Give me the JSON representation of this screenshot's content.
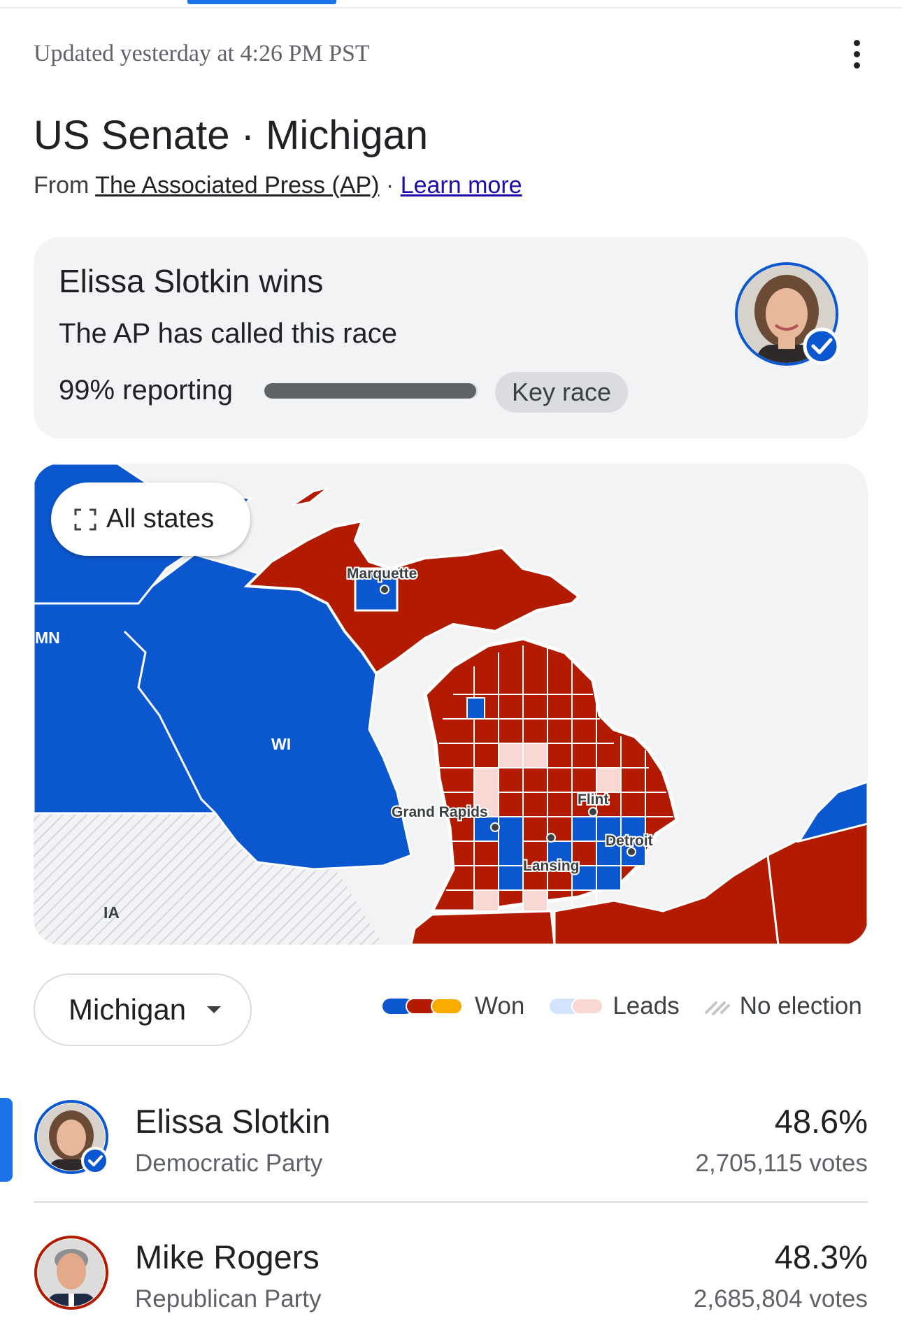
{
  "header": {
    "updated": "Updated yesterday at 4:26 PM PST"
  },
  "race": {
    "title": "US Senate · Michigan",
    "source_prefix": "From",
    "source_name": "The Associated Press (AP)",
    "separator": "·",
    "learn_more": "Learn more"
  },
  "call": {
    "winner_text": "Elissa Slotkin wins",
    "status_text": "The AP has called this race",
    "reporting_text": "99% reporting",
    "reporting_fraction": 0.99,
    "key_race_label": "Key race"
  },
  "map": {
    "all_states_label": "All states",
    "state_labels": [
      "MN",
      "WI",
      "IA"
    ],
    "city_labels": [
      "Marquette",
      "Grand Rapids",
      "Flint",
      "Detroit",
      "Lansing"
    ],
    "colors": {
      "dem_won": "#0b57d0",
      "rep_won": "#b31b00",
      "dem_leads": "#d3e3fd",
      "rep_leads": "#f9d8d4",
      "no_election_hatch": "#dadce0",
      "water": "#f1f3f4"
    }
  },
  "controls": {
    "state_select_value": "Michigan"
  },
  "legend": {
    "won": "Won",
    "leads": "Leads",
    "no_election": "No election",
    "won_colors": [
      "#0b57d0",
      "#b31b00",
      "#f9ab00"
    ],
    "leads_colors": [
      "#d3e3fd",
      "#f9d8d4"
    ]
  },
  "candidates": [
    {
      "name": "Elissa Slotkin",
      "party": "Democratic Party",
      "percent": "48.6%",
      "votes": "2,705,115 votes",
      "color": "#0b57d0",
      "winner": true
    },
    {
      "name": "Mike Rogers",
      "party": "Republican Party",
      "percent": "48.3%",
      "votes": "2,685,804 votes",
      "color": "#b31b00",
      "winner": false
    }
  ]
}
